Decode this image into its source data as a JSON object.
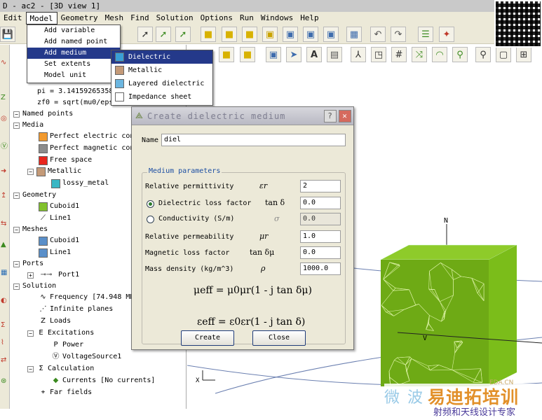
{
  "window": {
    "title": "D - ac2 - [3D view 1]"
  },
  "menu": [
    {
      "label": "Edit"
    },
    {
      "label": "Model"
    },
    {
      "label": "Geometry"
    },
    {
      "label": "Mesh"
    },
    {
      "label": "Find"
    },
    {
      "label": "Solution"
    },
    {
      "label": "Options"
    },
    {
      "label": "Run"
    },
    {
      "label": "Windows"
    },
    {
      "label": "Help"
    }
  ],
  "model_menu": {
    "items": [
      "Add variable",
      "Add named point",
      "Add medium",
      "Set extents",
      "Model unit"
    ],
    "submenu_arrow": "▸"
  },
  "medium_submenu": {
    "items": [
      "Dielectric",
      "Metallic",
      "Layered dielectric",
      "Impedance sheet"
    ]
  },
  "tree": {
    "vars": [
      "pi = 3.14159265358",
      "zf0 = sqrt(mu0/eps"
    ],
    "named_points": "Named points",
    "media": "Media",
    "media_items": [
      "Perfect electric con",
      "Perfect magnetic con",
      "Free space",
      "Metallic",
      "lossy_metal"
    ],
    "geometry": "Geometry",
    "geometry_items": [
      "Cuboid1",
      "Line1"
    ],
    "meshes": "Meshes",
    "mesh_items": [
      "Cuboid1",
      "Line1"
    ],
    "ports": "Ports",
    "port_items": [
      "Port1"
    ],
    "solution": "Solution",
    "solution_items": [
      "Frequency [74.948 MH",
      "Infinite planes",
      "Loads",
      "Excitations",
      "Power",
      "VoltageSource1",
      "Calculation",
      "Currents [No currents]",
      "Far fields"
    ],
    "expander_minus": "−",
    "expander_plus": "+"
  },
  "dialog": {
    "title": "Create dielectric medium",
    "help_btn": "?",
    "close_btn": "✕",
    "name_label": "Name",
    "name_value": "diel",
    "group_label": "Medium parameters",
    "rows": [
      {
        "label": "Relative permittivity",
        "symbol": "εr",
        "value": "2"
      },
      {
        "label": "Dielectric loss factor",
        "symbol": "tan δ",
        "value": "0.0"
      },
      {
        "label": "Conductivity (S/m)",
        "symbol": "σ",
        "value": "0.0"
      },
      {
        "label": "Relative permeability",
        "symbol": "μr",
        "value": "1.0"
      },
      {
        "label": "Magnetic loss factor",
        "symbol": "tan δμ",
        "value": "0.0"
      },
      {
        "label": "Mass density (kg/m^3)",
        "symbol": "ρ",
        "value": "1000.0"
      }
    ],
    "formula_mu": "μeff = μ0μr(1 - j tan δμ)",
    "formula_eps": "εeff = ε0εr(1 - j tan δ)",
    "create_btn": "Create",
    "close_label": "Close"
  },
  "viewport": {
    "axis_n": "N",
    "axis_x": "X",
    "axis_v": "V",
    "mesh_color": "#78b520"
  },
  "watermark": {
    "w1": "微 波",
    "w2": "易迪拓培训",
    "w3": "射频和天线设计专家",
    "w4": "EDA.CN"
  }
}
